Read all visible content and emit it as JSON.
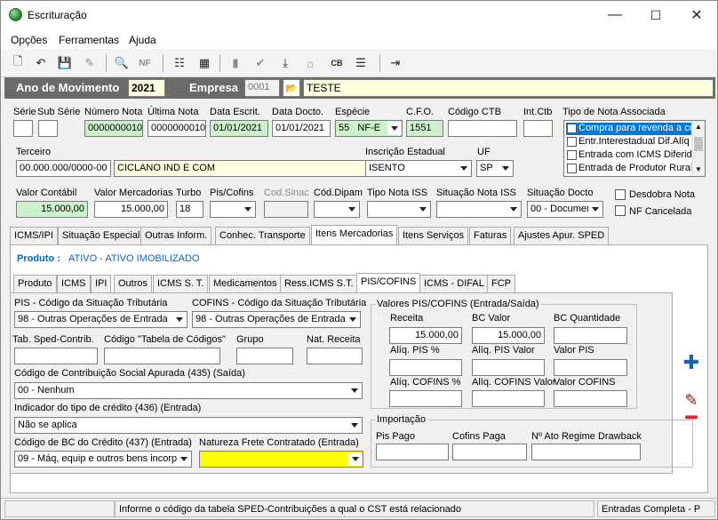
{
  "window": {
    "title": "Escrituração",
    "min": "—",
    "max": "☐",
    "close": "✕"
  },
  "menu": [
    "Opções",
    "Ferramentas",
    "Ajuda"
  ],
  "toolbar": {
    "icons": [
      "new-icon",
      "undo-icon",
      "save-icon",
      "delete-icon",
      "preview-icon",
      "nfe-icon",
      "tree-icon",
      "calculator-icon",
      "folder-icon",
      "check-icon",
      "download-icon",
      "home-icon",
      "cb-icon",
      "list-icon",
      "exit-icon"
    ]
  },
  "header": {
    "ano_label": "Ano de Movimento",
    "ano": "2021",
    "empresa_label": "Empresa",
    "empresa_code": "0001",
    "empresa_name": "TESTE"
  },
  "row1": {
    "serie": {
      "label": "Série",
      "value": ""
    },
    "subserie": {
      "label": "Sub Série",
      "value": ""
    },
    "numero": {
      "label": "Número Nota",
      "value": "0000000010"
    },
    "ultima": {
      "label": "Última Nota",
      "value": "0000000010"
    },
    "escrit": {
      "label": "Data Escrit.",
      "value": "01/01/2021"
    },
    "docto": {
      "label": "Data Docto.",
      "value": "01/01/2021"
    },
    "especie": {
      "label": "Espécie",
      "code": "55",
      "value": "NF-E"
    },
    "cfo": {
      "label": "C.F.O.",
      "value": "1551"
    },
    "ctb": {
      "label": "Código CTB",
      "value": ""
    },
    "intctb": {
      "label": "Int.Ctb",
      "value": ""
    }
  },
  "tipo_nota": {
    "label": "Tipo de Nota Associada",
    "items": [
      "Compra para revenda a co",
      "Entr.Interestadual Dif.Alíq",
      "Entrada com ICMS Diferido",
      "Entrada de Produtor Rural"
    ]
  },
  "terceiro": {
    "label": "Terceiro",
    "cnpj": "00.000.000/0000-00",
    "nome": "CICLANO IND E COM"
  },
  "inscricao": {
    "label": "Inscrição Estadual",
    "value": "ISENTO"
  },
  "uf": {
    "label": "UF",
    "value": "SP"
  },
  "row3": {
    "valor_contabil": {
      "label": "Valor Contábil",
      "value": "15.000,00"
    },
    "valor_merc": {
      "label": "Valor Mercadorias",
      "value": "15.000,00"
    },
    "turbo": {
      "label": "Turbo",
      "value": "18"
    },
    "piscofins": {
      "label": "Pis/Cofins",
      "value": ""
    },
    "codsinac": {
      "label": "Cod.Sinac",
      "value": ""
    },
    "coddipam": {
      "label": "Cód.Dipam",
      "value": ""
    },
    "tiponotaiss": {
      "label": "Tipo Nota ISS",
      "value": ""
    },
    "situacaoiss": {
      "label": "Situação Nota ISS",
      "value": ""
    },
    "situacaodocto": {
      "label": "Situação Docto",
      "value": "00 - Documen"
    }
  },
  "checks": {
    "desdobra": "Desdobra Nota",
    "cancelada": "NF Cancelada"
  },
  "tabs_main": [
    "ICMS/IPI",
    "Situação Especial",
    "Outras Inform.",
    "Conhec. Transporte",
    "Itens Mercadorias",
    "Itens Serviços",
    "Faturas",
    "Ajustes Apur. SPED"
  ],
  "produto": {
    "label": "Produto :",
    "value": "ATIVO - ATIVO IMOBILIZADO"
  },
  "tabs_sub": [
    "Produto",
    "ICMS",
    "IPI",
    "Outros",
    "ICMS S. T.",
    "Medicamentos",
    "Ress.ICMS S.T.",
    "PIS/COFINS",
    "ICMS - DIFAL",
    "FCP"
  ],
  "pis": {
    "cst_pis_label": "PIS - Código da Situação Tributária",
    "cst_pis": "98 - Outras Operações de Entrada",
    "cst_cofins_label": "COFINS - Código da Situação Tributária",
    "cst_cofins": "98 - Outras Operações de Entrada",
    "tab_sped_label": "Tab. Sped-Contrib.",
    "tab_codigos_label": "Código \"Tabela de Códigos\"",
    "grupo_label": "Grupo",
    "nat_receita_label": "Nat. Receita",
    "contrib_label": "Código de Contribuição Social Apurada (435)    (Saída)",
    "contrib": "00 - Nenhum",
    "credito_label": "Indicador do tipo de crédito (436)   (Entrada)",
    "credito": "Não se aplica",
    "bc_label": "Código de BC do Crédito (437) (Entrada)",
    "bc": "09 - Máq, equip e outros bens incorp",
    "frete_label": "Natureza Frete Contratado   (Entrada)",
    "frete": ""
  },
  "valores": {
    "title": "Valores PIS/COFINS    (Entrada/Saída)",
    "receita": {
      "label": "Receita",
      "value": "15.000,00"
    },
    "bc_valor": {
      "label": "BC Valor",
      "value": "15.000,00"
    },
    "bc_qtd": {
      "label": "BC Quantidade",
      "value": ""
    },
    "aliq_pis": {
      "label": "Alíq. PIS %",
      "value": ""
    },
    "aliq_pis_valor": {
      "label": "Alíq. PIS Valor",
      "value": ""
    },
    "valor_pis": {
      "label": "Valor PIS",
      "value": ""
    },
    "aliq_cofins": {
      "label": "Alíq. COFINS %",
      "value": ""
    },
    "aliq_cofins_valor": {
      "label": "Alíq. COFINS Valor",
      "value": ""
    },
    "valor_cofins": {
      "label": "Valor COFINS",
      "value": ""
    }
  },
  "importacao": {
    "title": "Importação",
    "pis_pago": "Pis Pago",
    "cofins_paga": "Cofins Paga",
    "ato": "Nº Ato Regime Drawback"
  },
  "status": {
    "hint": "Informe o código da tabela SPED-Contribuições a qual o CST está relacionado",
    "mode": "Entradas Completa - P"
  },
  "colors": {
    "header_bg": "#6b6b6b",
    "green_field": "#ccf2cc",
    "yellow_field": "#ffffe0",
    "highlight": "#ffff00",
    "link_blue": "#0066cc",
    "add_blue": "#1560bd",
    "remove_red": "#e0242a"
  }
}
